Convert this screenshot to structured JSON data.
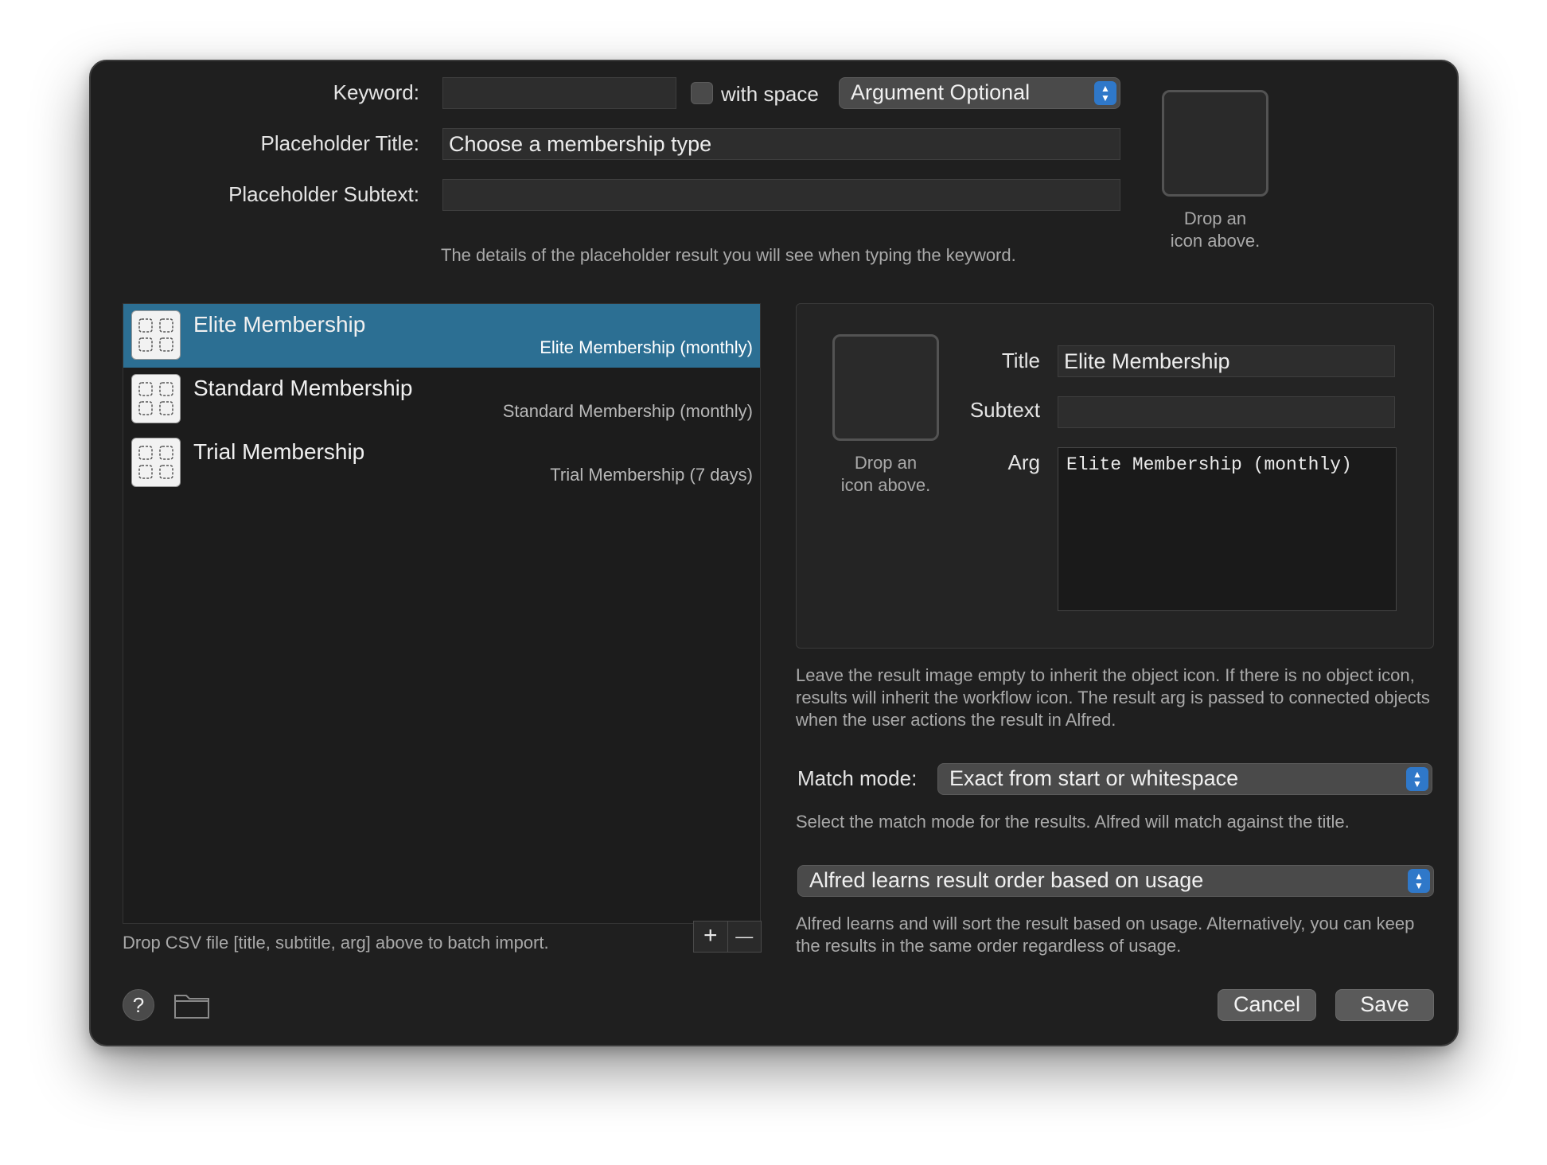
{
  "keyword": {
    "label": "Keyword:",
    "value": "",
    "with_space_label": "with space",
    "with_space_checked": false,
    "argument_mode": "Argument Optional"
  },
  "placeholder": {
    "title_label": "Placeholder Title:",
    "title_value": "Choose a membership type",
    "subtext_label": "Placeholder Subtext:",
    "subtext_value": "",
    "hint": "The details of the placeholder result you will see when typing the keyword."
  },
  "top_icon_well": {
    "caption_line1": "Drop an",
    "caption_line2": "icon above."
  },
  "results": [
    {
      "title": "Elite Membership",
      "subtitle": "Elite Membership (monthly)",
      "selected": true
    },
    {
      "title": "Standard Membership",
      "subtitle": "Standard Membership (monthly)",
      "selected": false
    },
    {
      "title": "Trial Membership",
      "subtitle": "Trial Membership (7 days)",
      "selected": false
    }
  ],
  "list_footer": {
    "hint": "Drop CSV file [title, subtitle, arg] above to batch import.",
    "add_label": "+",
    "remove_label": "—"
  },
  "detail": {
    "icon_caption_line1": "Drop an",
    "icon_caption_line2": "icon above.",
    "title_label": "Title",
    "title_value": "Elite Membership",
    "subtext_label": "Subtext",
    "subtext_value": "",
    "arg_label": "Arg",
    "arg_value": "Elite Membership (monthly)"
  },
  "detail_hint": "Leave the result image empty to inherit the object icon. If there is no object icon, results will inherit the workflow icon. The result arg is passed to connected objects when the user actions the result in Alfred.",
  "match_mode": {
    "label": "Match mode:",
    "value": "Exact from start or whitespace",
    "hint": "Select the match mode for the results. Alfred will match against the title."
  },
  "ordering": {
    "value": "Alfred learns result order based on usage",
    "hint": "Alfred learns and will sort the result based on usage. Alternatively, you can keep the results in the same order regardless of usage."
  },
  "footer": {
    "help_label": "?",
    "cancel_label": "Cancel",
    "save_label": "Save"
  },
  "colors": {
    "window_bg": "#1f1f1f",
    "selection": "#2c6f93",
    "popup_arrow_accent": "#2f78c9"
  }
}
